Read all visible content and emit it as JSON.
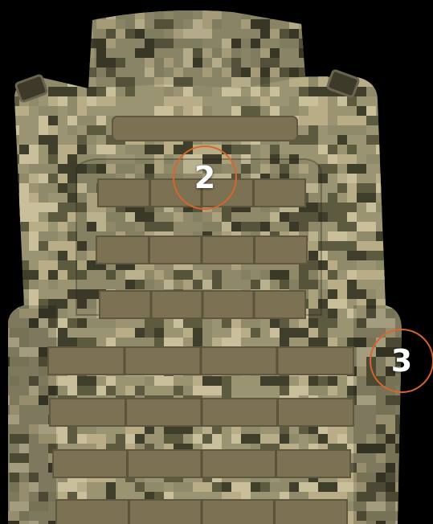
{
  "scene": {
    "subject": "plate-carrier-vest",
    "camouflage_colors": [
      "#8f8b6a",
      "#b8ad86",
      "#5c5a3f",
      "#3f3e2b",
      "#c9bf9a"
    ],
    "webbing_color": "#7c7152",
    "background_color": "#000000",
    "marker_color": "#d9652a"
  },
  "markers": [
    {
      "label": "2"
    },
    {
      "label": "3"
    }
  ]
}
